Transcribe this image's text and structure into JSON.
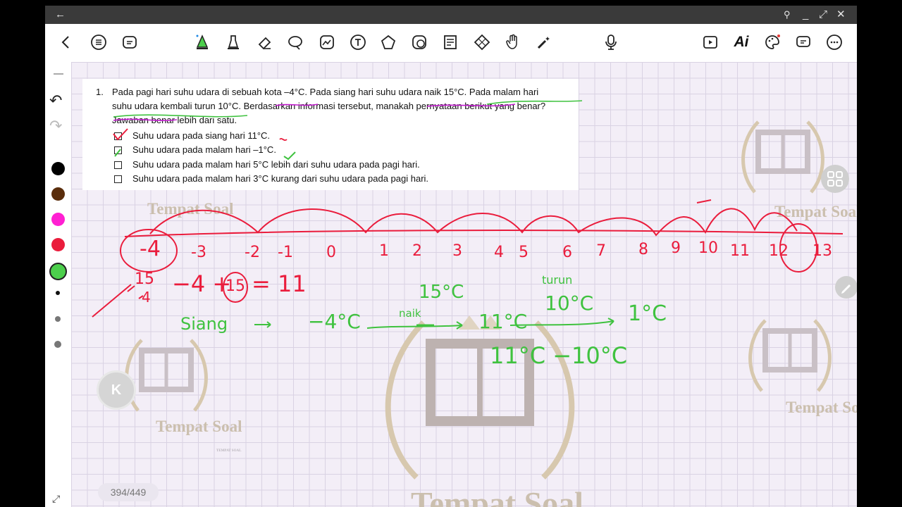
{
  "titlebar": {
    "back_icon": "arrow-left-icon",
    "pin_icon": "pin-icon",
    "minimize_icon": "minimize-icon",
    "expand_icon": "expand-icon",
    "close_icon": "close-icon"
  },
  "toolbar": {
    "icons": [
      "chevron-left-icon",
      "list-icon",
      "pages-icon",
      "pen-icon",
      "highlighter-icon",
      "eraser-icon",
      "lasso-icon",
      "image-icon",
      "text-icon",
      "shapes-icon",
      "sticker-icon",
      "outline-icon",
      "grid-icon",
      "hand-icon",
      "laser-icon",
      "microphone-icon",
      "video-icon",
      "ai-icon",
      "palette-icon",
      "comment-icon",
      "more-icon"
    ],
    "ai_label": "Ai"
  },
  "sidebar": {
    "colors": [
      "#000000",
      "#5a2d0c",
      "#ff1fd2",
      "#ea1c3c",
      "#4ccf4c"
    ],
    "selected_color": "#4ccf4c"
  },
  "question": {
    "number": "1.",
    "line1": "Pada pagi hari suhu udara di sebuah kota –4°C. Pada siang hari suhu udara naik 15°C. Pada malam hari",
    "line2": "suhu udara kembali turun 10°C. Berdasarkan informasi tersebut, manakah pernyataan berikut yang benar?",
    "line3": "Jawaban benar lebih dari satu.",
    "options": [
      "Suhu udara pada siang hari 11°C.",
      "Suhu udara pada malam hari –1°C.",
      "Suhu udara pada malam hari 5°C lebih dari suhu udara pada pagi hari.",
      "Suhu udara pada malam hari 3°C kurang dari suhu udara pada pagi hari."
    ]
  },
  "handwriting": {
    "number_line": [
      "-4",
      "-3",
      "-2",
      "-1",
      "0",
      "1",
      "2",
      "3",
      "4",
      "5",
      "6",
      "7",
      "8",
      "9",
      "10",
      "11",
      "12",
      "13"
    ],
    "sum_left": "15",
    "sum_left_bottom": "4",
    "equation_a": "−4 +",
    "equation_circled": "15",
    "equation_b": "= 11",
    "siang": "Siang",
    "arrow": "→",
    "minus4": "−4°C",
    "naik": "naik",
    "fifteen": "15°C",
    "eleven": "11°C",
    "turun": "turun",
    "ten": "10°C",
    "one": "1°C",
    "subtraction": "11°C −10°C"
  },
  "watermark": {
    "text": "Tempat Soal",
    "small_text": "TEMPAT SOAL"
  },
  "page_counter": "394/449",
  "floating": {
    "k_label": "K"
  }
}
